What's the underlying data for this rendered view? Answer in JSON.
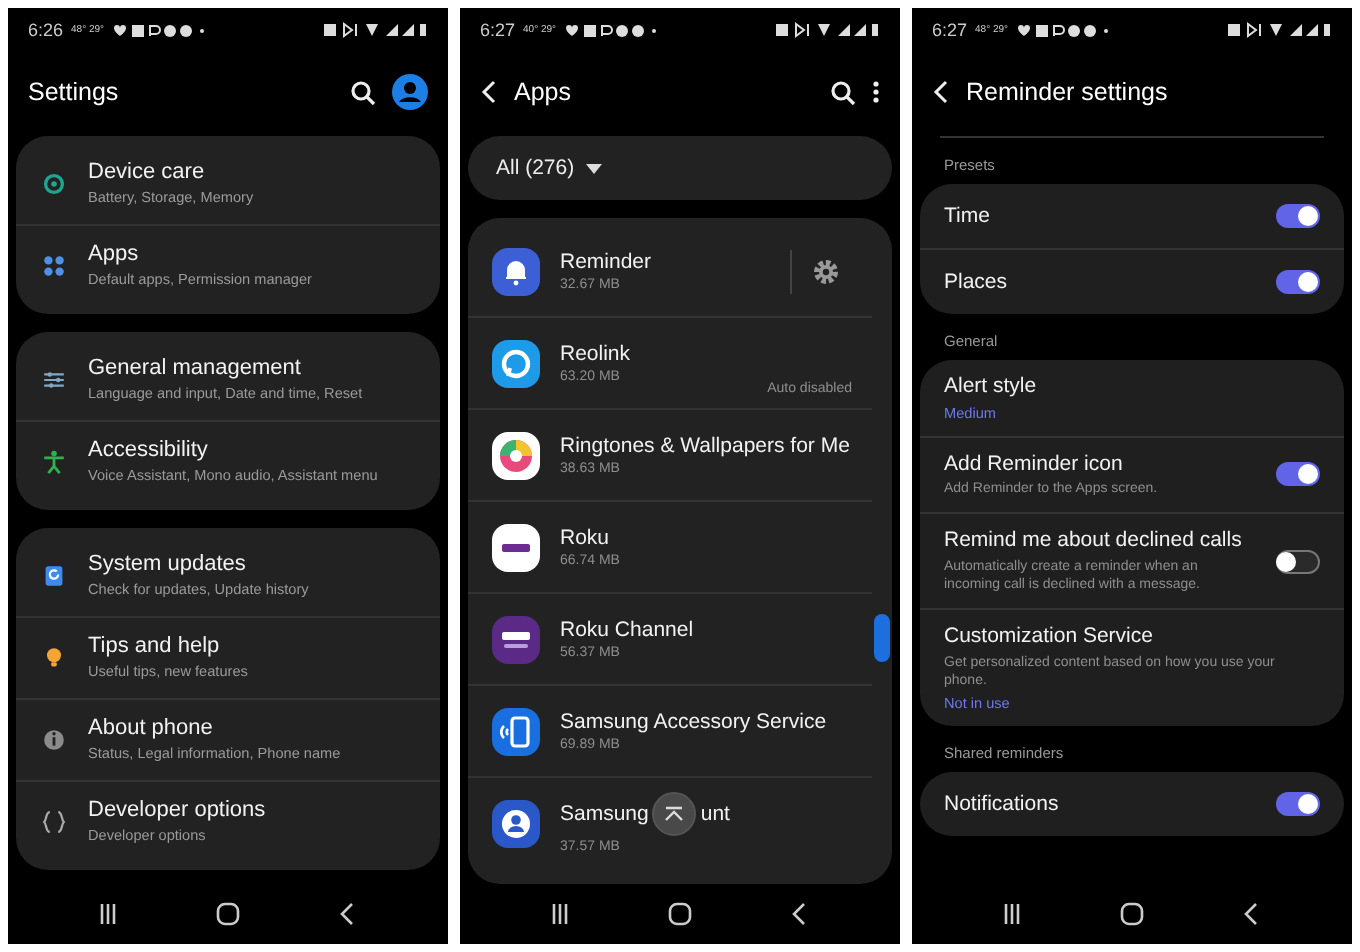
{
  "phones": [
    {
      "kind": "settings",
      "status": {
        "time": "6:26",
        "temps": "48° 29°"
      },
      "header": {
        "title": "Settings"
      },
      "groups": [
        {
          "items": [
            {
              "title": "Device care",
              "subtitle": "Battery, Storage, Memory"
            },
            {
              "title": "Apps",
              "subtitle": "Default apps, Permission manager"
            }
          ]
        },
        {
          "items": [
            {
              "title": "General management",
              "subtitle": "Language and input, Date and time, Reset"
            },
            {
              "title": "Accessibility",
              "subtitle": "Voice Assistant, Mono audio, Assistant menu"
            }
          ]
        },
        {
          "items": [
            {
              "title": "System updates",
              "subtitle": "Check for updates, Update history"
            },
            {
              "title": "Tips and help",
              "subtitle": "Useful tips, new features"
            },
            {
              "title": "About phone",
              "subtitle": "Status, Legal information, Phone name"
            },
            {
              "title": "Developer options",
              "subtitle": "Developer options"
            }
          ]
        }
      ]
    },
    {
      "kind": "apps",
      "status": {
        "time": "6:27",
        "temps": "40° 29°"
      },
      "header": {
        "title": "Apps"
      },
      "filter": {
        "label": "All (276)"
      },
      "apps": [
        {
          "name": "Reminder",
          "size": "32.67 MB",
          "gear": true
        },
        {
          "name": "Reolink",
          "size": "63.20 MB",
          "gear": false,
          "note": "Auto disabled"
        },
        {
          "name": "Ringtones & Wallpapers for Me",
          "size": "38.63 MB",
          "gear": false
        },
        {
          "name": "Roku",
          "size": "66.74 MB",
          "gear": false
        },
        {
          "name": "Roku Channel",
          "size": "56.37 MB",
          "gear": false
        },
        {
          "name": "Samsung Accessory Service",
          "size": "69.89 MB",
          "gear": false
        },
        {
          "name": "Samsung",
          "name_end": "unt",
          "size": "37.57 MB",
          "gear": false
        }
      ]
    },
    {
      "kind": "reminder",
      "status": {
        "time": "6:27",
        "temps": "48° 29°"
      },
      "header": {
        "title": "Reminder settings"
      },
      "sections": [
        {
          "label": "Presets",
          "rows": [
            {
              "kind": "switch",
              "title": "Time",
              "on": true
            },
            {
              "kind": "switch",
              "title": "Places",
              "on": true
            }
          ]
        },
        {
          "label": "General",
          "rows": [
            {
              "kind": "plain",
              "title": "Alert style",
              "value": "Medium"
            },
            {
              "kind": "switch",
              "title": "Add Reminder icon",
              "description": "Add Reminder to the Apps screen.",
              "on": true
            },
            {
              "kind": "switch",
              "title": "Remind me about declined calls",
              "description": "Automatically create a reminder when an incoming call is declined with a message.",
              "on": false
            },
            {
              "kind": "plain",
              "title": "Customization Service",
              "description": "Get personalized content based on how you use your phone.",
              "value": "Not in use"
            }
          ]
        },
        {
          "label": "Shared reminders",
          "rows": [
            {
              "kind": "switch",
              "title": "Notifications",
              "on": true
            }
          ]
        }
      ]
    }
  ]
}
